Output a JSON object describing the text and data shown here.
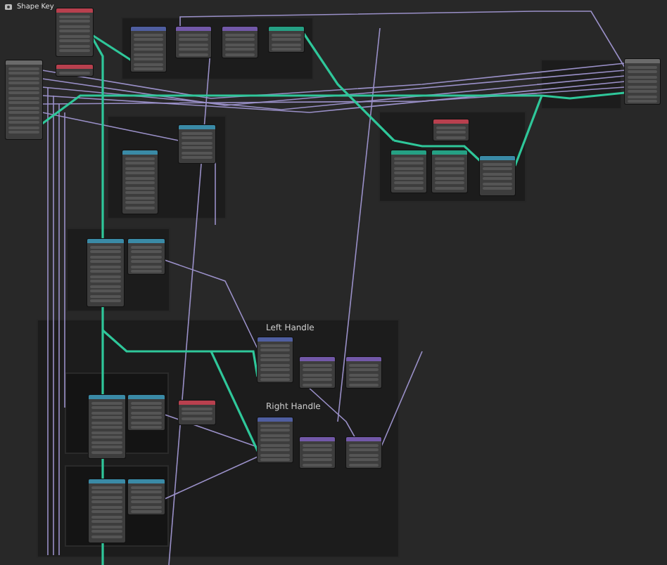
{
  "editor": {
    "breadcrumb": "Shape Key"
  },
  "frame_labels": [
    {
      "label": "Left Handle"
    },
    {
      "label": "Right Handle"
    }
  ],
  "nodes": [
    {
      "color": "#6a6a6a"
    },
    {
      "color": "#b8404e"
    },
    {
      "color": "#b8404e"
    },
    {
      "color": "#4f5ea0"
    },
    {
      "color": "#7258a8"
    },
    {
      "color": "#7258a8"
    },
    {
      "color": "#25a084"
    },
    {
      "color": "#3a8aa6"
    },
    {
      "color": "#3a8aa6"
    },
    {
      "color": "#b8404e"
    },
    {
      "color": "#25a084"
    },
    {
      "color": "#25a084"
    },
    {
      "color": "#3a8aa6"
    },
    {
      "color": "#3a8aa6"
    },
    {
      "color": "#3a8aa6"
    },
    {
      "color": "#4f5ea0"
    },
    {
      "color": "#7258a8"
    },
    {
      "color": "#7258a8"
    },
    {
      "color": "#4f5ea0"
    },
    {
      "color": "#7258a8"
    },
    {
      "color": "#7258a8"
    },
    {
      "color": "#b8404e"
    },
    {
      "color": "#3a8aa6"
    },
    {
      "color": "#3a8aa6"
    },
    {
      "color": "#3a8aa6"
    },
    {
      "color": "#3a8aa6"
    },
    {
      "color": "#6a6a6a"
    }
  ]
}
